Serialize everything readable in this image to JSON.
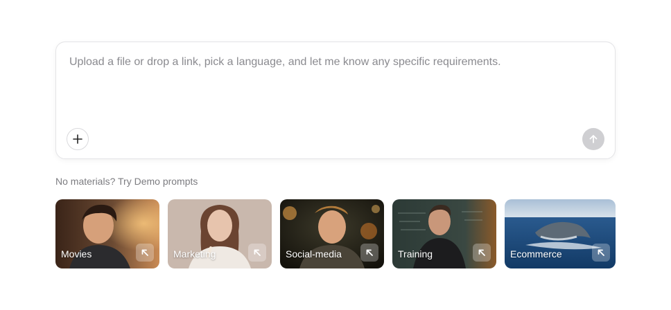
{
  "composer": {
    "placeholder": "Upload a file or drop a link, pick a language, and let me know any specific requirements.",
    "add_icon": "plus-icon",
    "send_icon": "arrow-up-icon"
  },
  "demo": {
    "heading": "No materials? Try Demo prompts",
    "cards": [
      {
        "label": "Movies",
        "icon": "arrow-up-left-icon"
      },
      {
        "label": "Marketing",
        "icon": "arrow-up-left-icon"
      },
      {
        "label": "Social-media",
        "icon": "arrow-up-left-icon"
      },
      {
        "label": "Training",
        "icon": "arrow-up-left-icon"
      },
      {
        "label": "Ecommerce",
        "icon": "arrow-up-left-icon"
      }
    ]
  },
  "colors": {
    "border": "#e3e3e6",
    "placeholder": "#8a8a8f",
    "send_disabled": "#cfcfd2",
    "muted_text": "#7c7c80"
  }
}
